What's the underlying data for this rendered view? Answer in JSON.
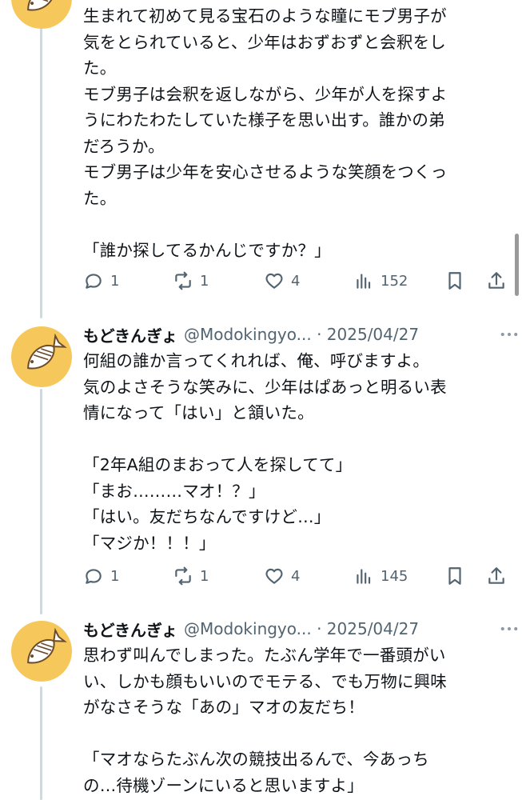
{
  "tweets": [
    {
      "name": "",
      "handle": "",
      "body": "生まれて初めて見る宝石のような瞳にモブ男子が\n気をとられていると、少年はおずおずと会釈をし\nた。\nモブ男子は会釈を返しながら、少年が人を探すよ\nうにわたわたしていた様子を思い出す。誰かの弟\nだろうか。\nモブ男子は少年を安心させるような笑顔をつくっ\nた。\n\n「誰か探してるかんじですか？」",
      "replies": "1",
      "retweets": "1",
      "likes": "4",
      "views": "152"
    },
    {
      "name": "もどきんぎょ",
      "handle": "@Modokingyo... · 2025/04/27",
      "body": "何組の誰か言ってくれれば、俺、呼びますよ。\n気のよさそうな笑みに、少年はぱあっと明るい表\n情になって「はい」と頷いた。\n\n「2年A組のまおって人を探してて」\n「まお………マオ！？」\n「はい。友だちなんですけど…」\n「マジか！！！」",
      "replies": "1",
      "retweets": "1",
      "likes": "4",
      "views": "145"
    },
    {
      "name": "もどきんぎょ",
      "handle": "@Modokingyo... · 2025/04/27",
      "body": "思わず叫んでしまった。たぶん学年で一番頭がい\nい、しかも顔もいいのでモテる、でも万物に興味\nがなさそうな「あの」マオの友だち！\n\n「マオならたぶん次の競技出るんで、今あっち\nの…待機ゾーンにいると思いますよ」"
    }
  ],
  "colors": {
    "text": "#0f1419",
    "secondary": "#536471",
    "thread_line": "#cfd9de",
    "avatar_bg": "#f6c75a"
  },
  "icons": [
    "reply-icon",
    "retweet-icon",
    "like-icon",
    "views-icon",
    "bookmark-icon",
    "share-icon",
    "more-icon",
    "fish-avatar"
  ]
}
